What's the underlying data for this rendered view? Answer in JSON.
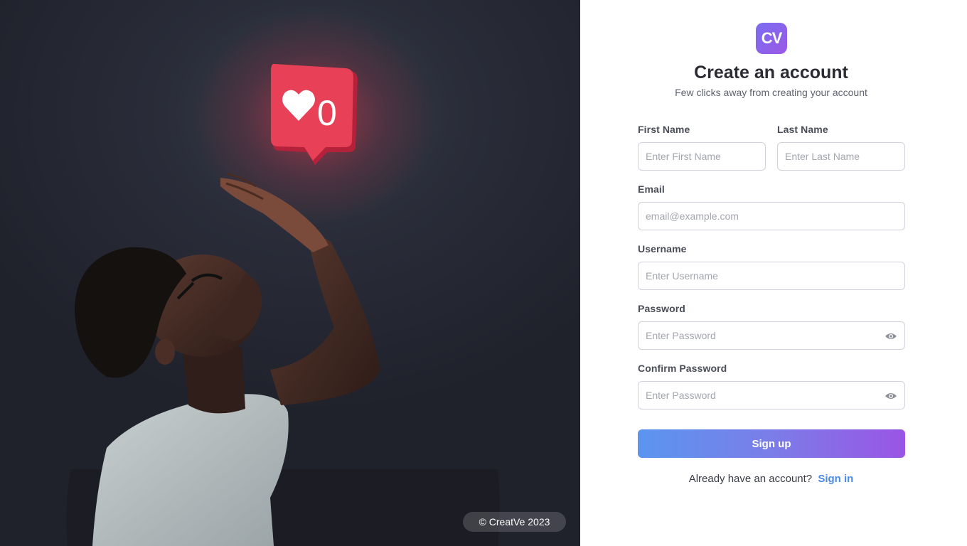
{
  "hero": {
    "copyright": "© CreatVe 2023",
    "like_count": "0"
  },
  "logo": {
    "text": "CV"
  },
  "header": {
    "title": "Create an account",
    "subtitle": "Few clicks away from creating your account"
  },
  "form": {
    "first_name": {
      "label": "First Name",
      "placeholder": "Enter First Name",
      "value": ""
    },
    "last_name": {
      "label": "Last Name",
      "placeholder": "Enter Last Name",
      "value": ""
    },
    "email": {
      "label": "Email",
      "placeholder": "email@example.com",
      "value": ""
    },
    "username": {
      "label": "Username",
      "placeholder": "Enter Username",
      "value": ""
    },
    "password": {
      "label": "Password",
      "placeholder": "Enter Password",
      "value": ""
    },
    "confirm_password": {
      "label": "Confirm Password",
      "placeholder": "Enter Password",
      "value": ""
    },
    "submit_label": "Sign up"
  },
  "footer": {
    "prompt": "Already have an account?",
    "link": "Sign in"
  },
  "icons": {
    "password_toggle": "eye-icon",
    "like_badge": "heart-icon"
  },
  "colors": {
    "accent_start": "#5b95f0",
    "accent_end": "#9a55e4",
    "link": "#4a8ae8",
    "like_red": "#e23d4f"
  }
}
